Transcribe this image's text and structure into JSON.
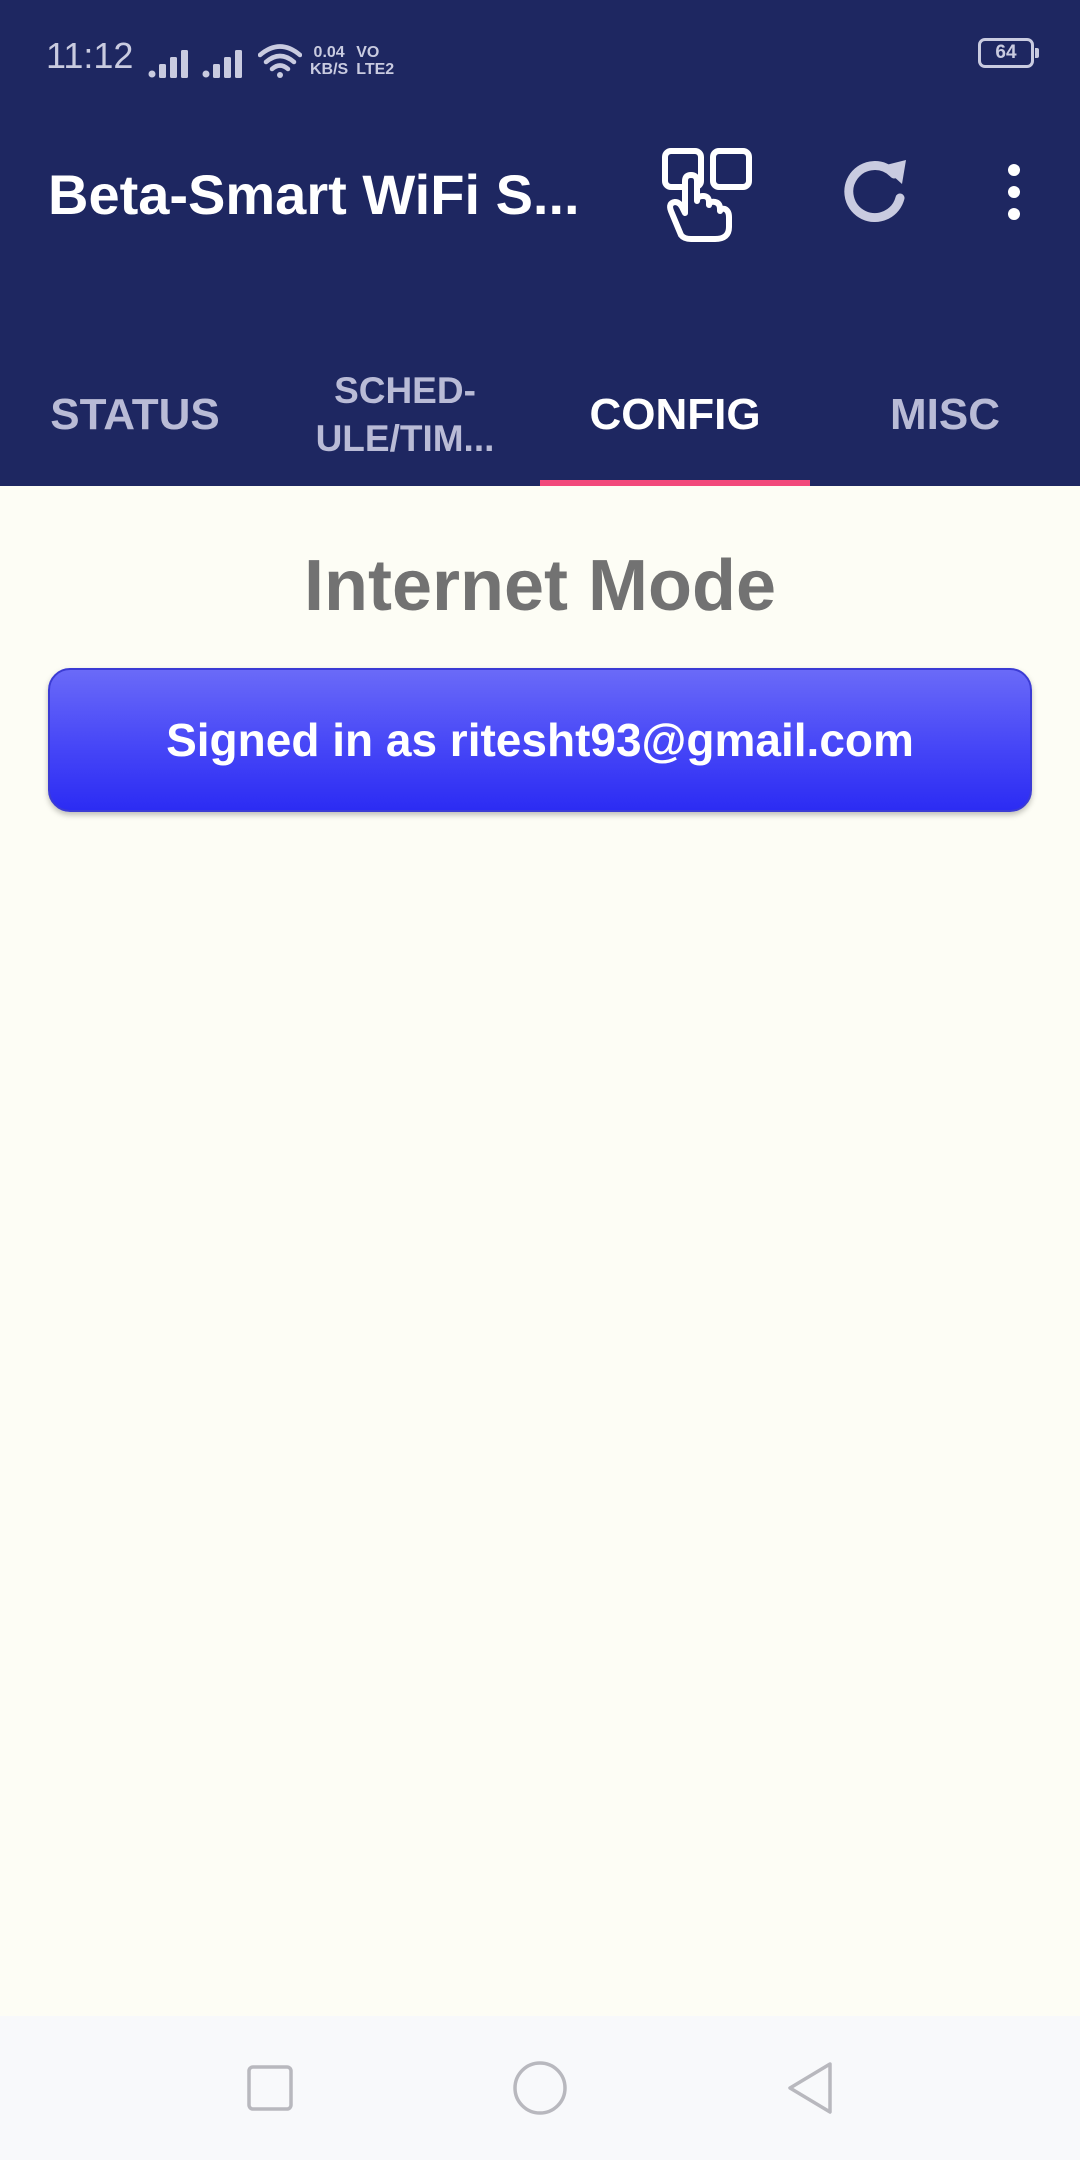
{
  "status_bar": {
    "time": "11:12",
    "net_speed_value": "0.04",
    "net_speed_unit": "KB/S",
    "volte_top": "VO",
    "volte_bottom": "LTE2",
    "battery": "64"
  },
  "toolbar": {
    "title": "Beta-Smart WiFi S...",
    "icons": [
      "touch-select-icon",
      "refresh-icon",
      "more-vert-icon"
    ]
  },
  "tabs": [
    {
      "label": "STATUS",
      "active": false
    },
    {
      "label_line1": "SCHED-",
      "label_line2": "ULE/TIM...",
      "active": false
    },
    {
      "label": "CONFIG",
      "active": true
    },
    {
      "label": "MISC",
      "active": false
    }
  ],
  "content": {
    "section_title": "Internet Mode",
    "signin_label": "Signed in as ritesht93@gmail.com"
  },
  "colors": {
    "header_bg": "#1e2761",
    "tab_indicator": "#f2497b",
    "button_blue": "#4646f7",
    "page_bg": "#fdfdf5"
  }
}
